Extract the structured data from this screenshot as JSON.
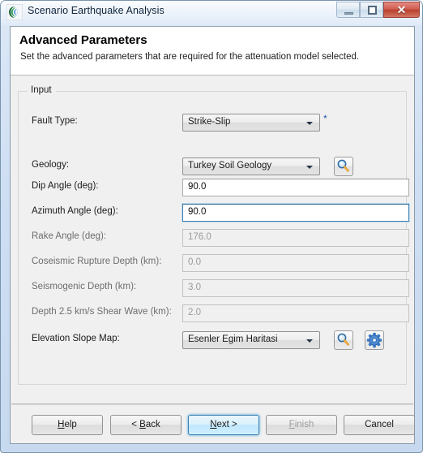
{
  "window": {
    "title": "Scenario Earthquake Analysis",
    "app_icon": "seismic-waves-icon",
    "controls": {
      "minimize": "minimize-icon",
      "maximize": "restore-icon",
      "close": "✕"
    }
  },
  "header": {
    "title": "Advanced Parameters",
    "description": "Set the advanced parameters that are required for the attenuation model selected."
  },
  "group": {
    "legend": "Input"
  },
  "fields": [
    {
      "label": "Fault Type:",
      "type": "combo",
      "value": "Strike-Slip",
      "required_marker": "*",
      "disabled": false,
      "focused": false
    },
    {
      "label": "Geology:",
      "type": "combo",
      "value": "Turkey Soil Geology",
      "disabled": false,
      "focused": false,
      "browse_icon": "magnifier-icon"
    },
    {
      "label": "Dip Angle (deg):",
      "type": "text",
      "value": "90.0",
      "disabled": false,
      "focused": false
    },
    {
      "label": "Azimuth Angle (deg):",
      "type": "text",
      "value": "90.0",
      "disabled": false,
      "focused": true
    },
    {
      "label": "Rake Angle (deg):",
      "type": "text",
      "value": "176.0",
      "disabled": true,
      "focused": false
    },
    {
      "label": "Coseismic Rupture Depth (km):",
      "type": "text",
      "value": "0.0",
      "disabled": true,
      "focused": false
    },
    {
      "label": "Seismogenic Depth (km):",
      "type": "text",
      "value": "3.0",
      "disabled": true,
      "focused": false
    },
    {
      "label": "Depth 2.5 km/s Shear Wave (km):",
      "type": "text",
      "value": "2.0",
      "disabled": true,
      "focused": false
    },
    {
      "label": "Elevation Slope Map:",
      "type": "combo",
      "value": "Esenler Egim Haritasi",
      "disabled": false,
      "focused": false,
      "browse_icon": "magnifier-icon",
      "settings_icon": "gear-icon"
    }
  ],
  "footer": {
    "buttons": [
      {
        "name": "help",
        "prefix": "",
        "mnemonic": "H",
        "suffix": "elp",
        "state": "normal"
      },
      {
        "name": "back",
        "prefix": "< ",
        "mnemonic": "B",
        "suffix": "ack",
        "state": "normal"
      },
      {
        "name": "next",
        "prefix": "",
        "mnemonic": "N",
        "suffix": "ext >",
        "state": "default"
      },
      {
        "name": "finish",
        "prefix": "",
        "mnemonic": "F",
        "suffix": "inish",
        "state": "disabled"
      },
      {
        "name": "cancel",
        "prefix": "",
        "mnemonic": "",
        "suffix": "Cancel",
        "state": "normal"
      }
    ]
  },
  "colors": {
    "accent_blue": "#3c7fb1",
    "required_marker": "#2255aa",
    "titlebar": "#cfdff3",
    "dialog_bg": "#f0f0f0",
    "close_button": "#b8402f"
  }
}
